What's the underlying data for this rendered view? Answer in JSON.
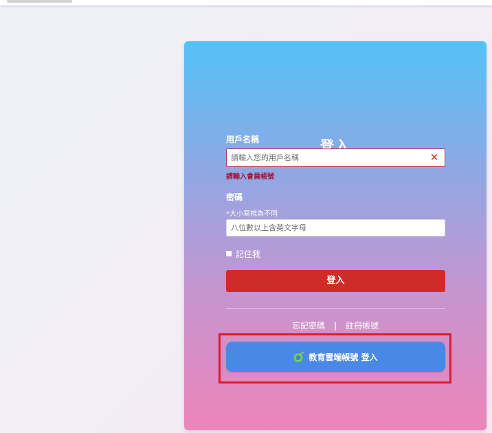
{
  "login": {
    "title": "登入",
    "username": {
      "label": "用戶名稱",
      "placeholder": "請輸入您的用戶名稱",
      "error": "請輸入會員帳號",
      "clear_symbol": "✕"
    },
    "password": {
      "label": "密碼",
      "hint": "*大小寫視為不同",
      "placeholder": "八位數以上含英文字母"
    },
    "remember_label": "記住我",
    "submit_label": "登入",
    "links": {
      "forgot_password": "忘記密碼",
      "separator": "|",
      "register": "註冊帳號"
    },
    "edu_cloud_button_label": "教育雲端帳號 登入",
    "icons": {
      "clear": "close-icon",
      "edu_cloud": "education-cloud-logo-icon",
      "checkbox": "checkbox-icon"
    }
  },
  "colors": {
    "submit_button": "#cf2b27",
    "edu_button": "#4a88e6",
    "highlight": "#dd1b2a",
    "error_text": "#a01a34"
  }
}
